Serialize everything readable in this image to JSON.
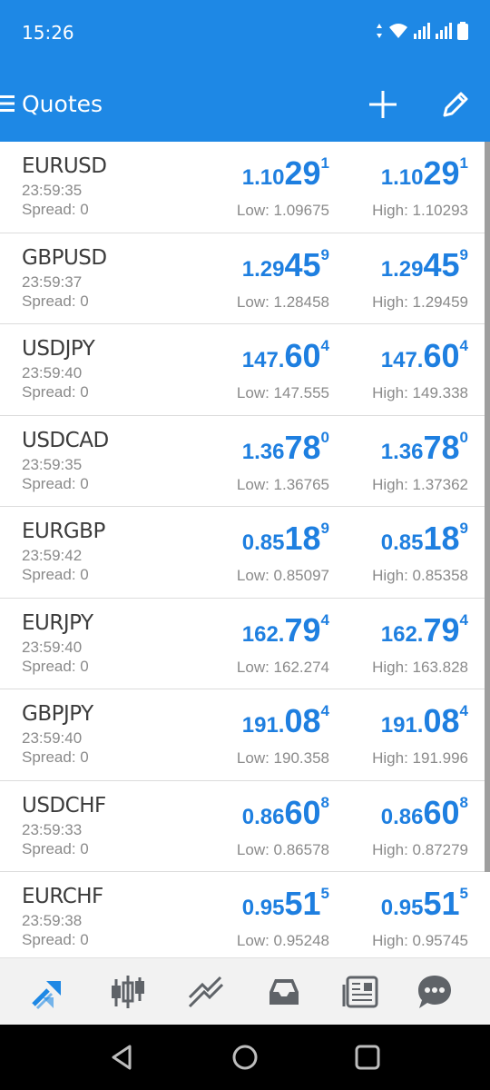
{
  "status_bar": {
    "time": "15:26"
  },
  "toolbar": {
    "title": "Quotes"
  },
  "quotes": [
    {
      "symbol": "EURUSD",
      "time": "23:59:35",
      "spread": "Spread: 0",
      "bid": {
        "small": "1.10",
        "big": "29",
        "sup": "1"
      },
      "ask": {
        "small": "1.10",
        "big": "29",
        "sup": "1"
      },
      "low": "Low: 1.09675",
      "high": "High: 1.10293"
    },
    {
      "symbol": "GBPUSD",
      "time": "23:59:37",
      "spread": "Spread: 0",
      "bid": {
        "small": "1.29",
        "big": "45",
        "sup": "9"
      },
      "ask": {
        "small": "1.29",
        "big": "45",
        "sup": "9"
      },
      "low": "Low: 1.28458",
      "high": "High: 1.29459"
    },
    {
      "symbol": "USDJPY",
      "time": "23:59:40",
      "spread": "Spread: 0",
      "bid": {
        "small": "147.",
        "big": "60",
        "sup": "4"
      },
      "ask": {
        "small": "147.",
        "big": "60",
        "sup": "4"
      },
      "low": "Low: 147.555",
      "high": "High: 149.338"
    },
    {
      "symbol": "USDCAD",
      "time": "23:59:35",
      "spread": "Spread: 0",
      "bid": {
        "small": "1.36",
        "big": "78",
        "sup": "0"
      },
      "ask": {
        "small": "1.36",
        "big": "78",
        "sup": "0"
      },
      "low": "Low: 1.36765",
      "high": "High: 1.37362"
    },
    {
      "symbol": "EURGBP",
      "time": "23:59:42",
      "spread": "Spread: 0",
      "bid": {
        "small": "0.85",
        "big": "18",
        "sup": "9"
      },
      "ask": {
        "small": "0.85",
        "big": "18",
        "sup": "9"
      },
      "low": "Low: 0.85097",
      "high": "High: 0.85358"
    },
    {
      "symbol": "EURJPY",
      "time": "23:59:40",
      "spread": "Spread: 0",
      "bid": {
        "small": "162.",
        "big": "79",
        "sup": "4"
      },
      "ask": {
        "small": "162.",
        "big": "79",
        "sup": "4"
      },
      "low": "Low: 162.274",
      "high": "High: 163.828"
    },
    {
      "symbol": "GBPJPY",
      "time": "23:59:40",
      "spread": "Spread: 0",
      "bid": {
        "small": "191.",
        "big": "08",
        "sup": "4"
      },
      "ask": {
        "small": "191.",
        "big": "08",
        "sup": "4"
      },
      "low": "Low: 190.358",
      "high": "High: 191.996"
    },
    {
      "symbol": "USDCHF",
      "time": "23:59:33",
      "spread": "Spread: 0",
      "bid": {
        "small": "0.86",
        "big": "60",
        "sup": "8"
      },
      "ask": {
        "small": "0.86",
        "big": "60",
        "sup": "8"
      },
      "low": "Low: 0.86578",
      "high": "High: 0.87279"
    },
    {
      "symbol": "EURCHF",
      "time": "23:59:38",
      "spread": "Spread: 0",
      "bid": {
        "small": "0.95",
        "big": "51",
        "sup": "5"
      },
      "ask": {
        "small": "0.95",
        "big": "51",
        "sup": "5"
      },
      "low": "Low: 0.95248",
      "high": "High: 0.95745"
    }
  ],
  "bottom_tabs": [
    {
      "icon": "quotes-arrows-icon",
      "active": true
    },
    {
      "icon": "candlestick-chart-icon",
      "active": false
    },
    {
      "icon": "trade-trend-icon",
      "active": false
    },
    {
      "icon": "inbox-icon",
      "active": false
    },
    {
      "icon": "news-icon",
      "active": false
    },
    {
      "icon": "chat-bubble-icon",
      "active": false
    }
  ],
  "colors": {
    "accent": "#1e88e5",
    "price": "#1e7fe0",
    "muted": "#8a8a8a",
    "icon_gray": "#5f6368"
  }
}
